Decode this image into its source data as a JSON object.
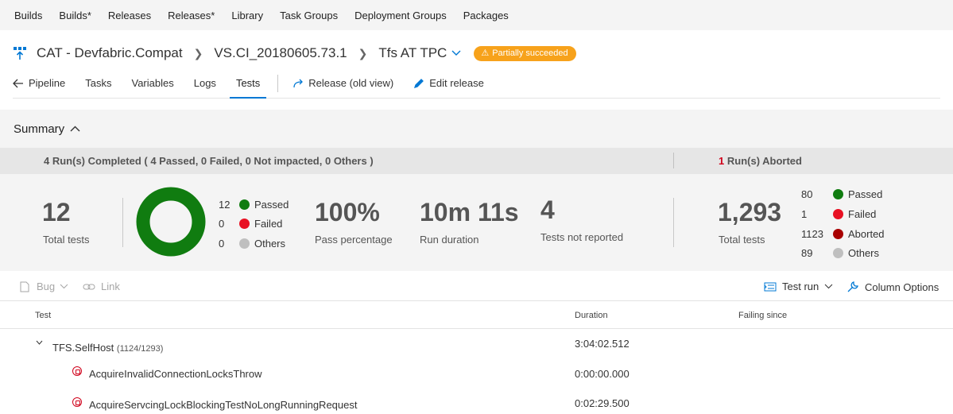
{
  "topnav": [
    "Builds",
    "Builds*",
    "Releases",
    "Releases*",
    "Library",
    "Task Groups",
    "Deployment Groups",
    "Packages"
  ],
  "header": {
    "definition": "CAT - Devfabric.Compat",
    "release": "VS.CI_20180605.73.1",
    "environment": "Tfs AT TPC",
    "status": "Partially succeeded"
  },
  "tabs": {
    "pipeline": "Pipeline",
    "tasks": "Tasks",
    "variables": "Variables",
    "logs": "Logs",
    "tests": "Tests",
    "release_old": "Release (old view)",
    "edit_release": "Edit release"
  },
  "summary": {
    "title": "Summary",
    "completed_text": "4 Run(s) Completed ( 4 Passed, 0 Failed, 0 Not impacted, 0 Others )",
    "aborted_count": "1",
    "aborted_text": "Run(s) Aborted"
  },
  "completed": {
    "total": "12",
    "total_label": "Total tests",
    "legend": [
      {
        "count": "12",
        "label": "Passed",
        "color": "#107c10"
      },
      {
        "count": "0",
        "label": "Failed",
        "color": "#e81123"
      },
      {
        "count": "0",
        "label": "Others",
        "color": "#bfbfbf"
      }
    ],
    "pass_pct": "100%",
    "pass_pct_label": "Pass percentage",
    "duration": "10m 11s",
    "duration_label": "Run duration",
    "not_reported": "4",
    "not_reported_label": "Tests not reported"
  },
  "aborted": {
    "total": "1,293",
    "total_label": "Total tests",
    "legend": [
      {
        "count": "80",
        "label": "Passed",
        "color": "#107c10"
      },
      {
        "count": "1",
        "label": "Failed",
        "color": "#e81123"
      },
      {
        "count": "1123",
        "label": "Aborted",
        "color": "#a80000"
      },
      {
        "count": "89",
        "label": "Others",
        "color": "#bfbfbf"
      }
    ]
  },
  "toolbar": {
    "bug": "Bug",
    "link": "Link",
    "test_run": "Test run",
    "column_options": "Column Options"
  },
  "table": {
    "columns": {
      "test": "Test",
      "duration": "Duration",
      "failing_since": "Failing since"
    },
    "group": {
      "name": "TFS.SelfHost",
      "count": "(1124/1293)",
      "duration": "3:04:02.512"
    },
    "rows": [
      {
        "name": "AcquireInvalidConnectionLocksThrow",
        "duration": "0:00:00.000"
      },
      {
        "name": "AcquireServcingLockBlockingTestNoLongRunningRequest",
        "duration": "0:02:29.500"
      }
    ]
  }
}
